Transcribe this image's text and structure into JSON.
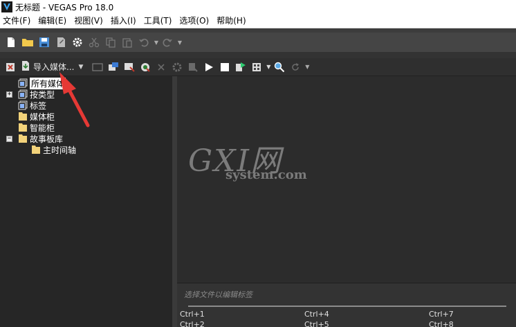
{
  "window": {
    "title": "无标题 - VEGAS Pro 18.0",
    "logo": "vegas-logo"
  },
  "menu": {
    "items": [
      {
        "label": "文件(F)"
      },
      {
        "label": "编辑(E)"
      },
      {
        "label": "视图(V)"
      },
      {
        "label": "插入(I)"
      },
      {
        "label": "工具(T)"
      },
      {
        "label": "选项(O)"
      },
      {
        "label": "帮助(H)"
      }
    ]
  },
  "toolbar": {
    "icons": [
      "new-file-icon",
      "open-folder-icon",
      "save-icon",
      "render-icon",
      "properties-gear-icon",
      "cut-icon",
      "copy-icon",
      "paste-icon",
      "undo-icon",
      "redo-icon"
    ]
  },
  "media_toolbar": {
    "import_label": "导入媒体...",
    "icons": [
      "remove-unused-icon",
      "import-media-icon",
      "capture-video-icon",
      "get-photo-icon",
      "get-media-web-icon",
      "media-fx-icon",
      "delete-icon",
      "properties-icon",
      "media-generators-icon",
      "play-icon",
      "stop-icon",
      "auto-preview-icon",
      "views-icon",
      "search-icon",
      "refresh-icon"
    ]
  },
  "tree": {
    "items": [
      {
        "label": "所有媒体",
        "selected": true,
        "expander": "",
        "icon": "bin-icon"
      },
      {
        "label": "按类型",
        "selected": false,
        "expander": "+",
        "icon": "bin-icon"
      },
      {
        "label": "标签",
        "selected": false,
        "expander": "",
        "icon": "bin-icon"
      },
      {
        "label": "媒体柜",
        "selected": false,
        "expander": "",
        "icon": "folder-icon"
      },
      {
        "label": "智能柜",
        "selected": false,
        "expander": "",
        "icon": "folder-icon"
      },
      {
        "label": "故事板库",
        "selected": false,
        "expander": "−",
        "icon": "folder-icon"
      },
      {
        "label": "主时间轴",
        "selected": false,
        "expander": "",
        "icon": "folder-icon"
      }
    ]
  },
  "watermark": {
    "main": "GXI网",
    "sub": "system.com"
  },
  "tag_panel": {
    "hint": "选择文件以编辑标签",
    "shortcuts": [
      "Ctrl+1",
      "Ctrl+4",
      "Ctrl+7",
      "Ctrl+2",
      "Ctrl+5",
      "Ctrl+8"
    ]
  },
  "colors": {
    "background": "#2d2d2d",
    "panel": "#262626",
    "arrow": "#e53935",
    "folder": "#f2d27a"
  }
}
